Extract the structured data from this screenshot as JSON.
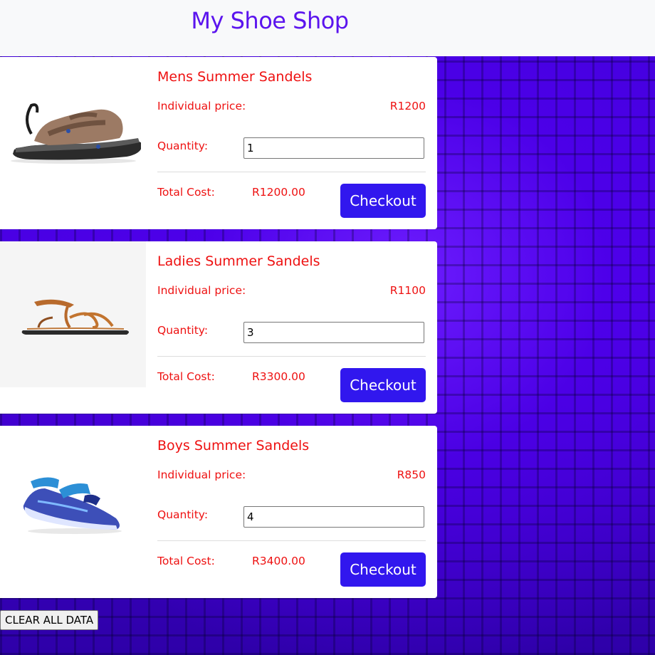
{
  "header": {
    "title": "My Shoe Shop"
  },
  "labels": {
    "individual_price": "Individual price:",
    "quantity": "Quantity:",
    "total_cost": "Total Cost:",
    "checkout": "Checkout"
  },
  "products": [
    {
      "name": "Mens Summer Sandels",
      "price": "R1200",
      "quantity": "1",
      "total": "R1200.00",
      "image_icon": "mens-sandal-image"
    },
    {
      "name": "Ladies Summer Sandels",
      "price": "R1100",
      "quantity": "3",
      "total": "R3300.00",
      "image_icon": "ladies-sandal-image"
    },
    {
      "name": "Boys Summer Sandels",
      "price": "R850",
      "quantity": "4",
      "total": "R3400.00",
      "image_icon": "boys-sandal-image"
    }
  ],
  "footer": {
    "clear_label": "CLEAR ALL DATA"
  },
  "colors": {
    "title": "#5b14ee",
    "product_text": "#ee1111",
    "button": "#3117ee",
    "background": "#4c00e6"
  }
}
